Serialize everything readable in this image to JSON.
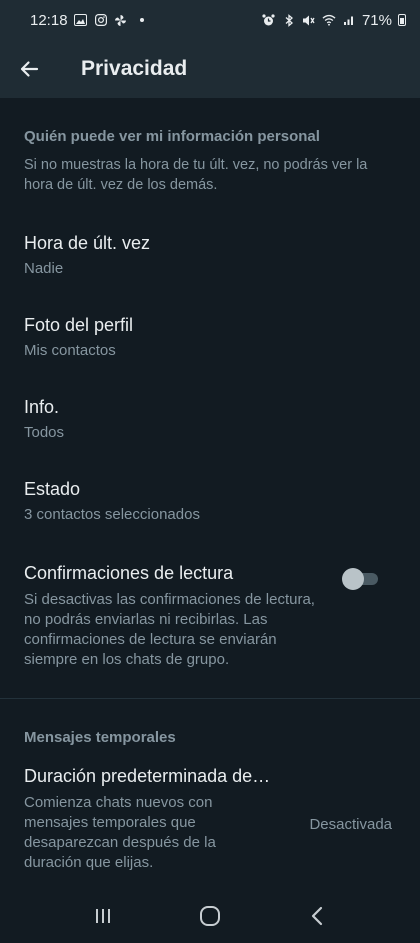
{
  "status_bar": {
    "time": "12:18",
    "battery": "71%",
    "left_icons": [
      "image-icon",
      "instagram-icon",
      "pinwheel-icon"
    ],
    "right_icons": [
      "alarm-icon",
      "bluetooth-icon",
      "mute-icon",
      "wifi-icon",
      "signal-icon",
      "battery-icon"
    ]
  },
  "header": {
    "title": "Privacidad",
    "back_icon": "arrow-left-icon"
  },
  "personal_info": {
    "heading": "Quién puede ver mi información personal",
    "description": "Si no muestras la hora de tu últ. vez, no podrás ver la hora de últ. vez de los demás.",
    "items": [
      {
        "title": "Hora de últ. vez",
        "value": "Nadie"
      },
      {
        "title": "Foto del perfil",
        "value": "Mis contactos"
      },
      {
        "title": "Info.",
        "value": "Todos"
      },
      {
        "title": "Estado",
        "value": "3 contactos seleccionados"
      }
    ]
  },
  "read_receipts": {
    "title": "Confirmaciones de lectura",
    "description": "Si desactivas las confirmaciones de lectura, no podrás enviarlas ni recibirlas. Las confirmaciones de lectura se enviarán siempre en los chats de grupo.",
    "enabled": false
  },
  "temporary": {
    "heading": "Mensajes temporales",
    "title": "Duración predeterminada de…",
    "description": "Comienza chats nuevos con mensajes temporales que desaparezcan después de la duración que elijas.",
    "value": "Desactivada"
  },
  "colors": {
    "background": "#121b22",
    "appbar": "#1f2c34",
    "secondary_text": "#8696a0",
    "primary_text": "#e9edef"
  },
  "nav_bar": {
    "icons": [
      "recents-icon",
      "home-icon",
      "back-icon"
    ]
  }
}
